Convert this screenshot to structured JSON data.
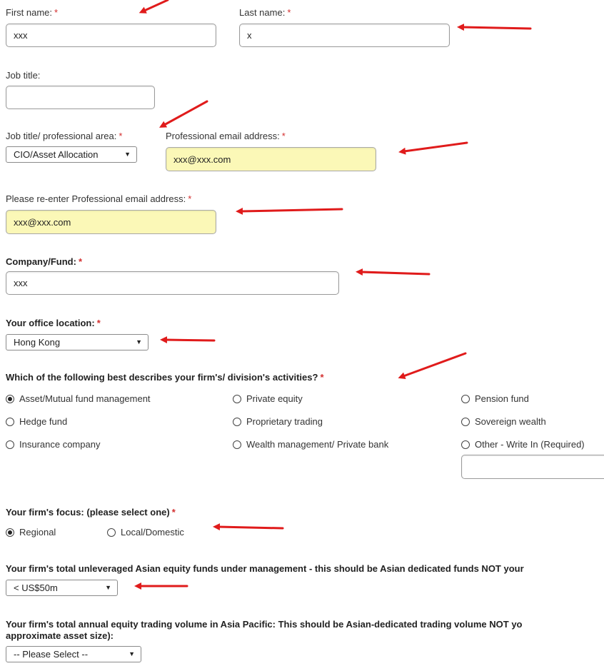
{
  "required_mark": "*",
  "first_name": {
    "label": "First name:",
    "value": "xxx"
  },
  "last_name": {
    "label": "Last name:",
    "value": "x"
  },
  "job_title": {
    "label": "Job title:",
    "value": ""
  },
  "professional_area": {
    "label": "Job title/ professional area:",
    "selected": "CIO/Asset Allocation"
  },
  "email": {
    "label": "Professional email address:",
    "value": "xxx@xxx.com"
  },
  "email_confirm": {
    "label": "Please re-enter Professional email address:",
    "value": "xxx@xxx.com"
  },
  "company": {
    "label": "Company/Fund:",
    "value": "xxx"
  },
  "office_location": {
    "label": "Your office location:",
    "selected": "Hong Kong"
  },
  "activities": {
    "label": "Which of the following best describes your firm's/ division's activities?",
    "options": [
      {
        "label": "Asset/Mutual fund management",
        "checked": true
      },
      {
        "label": "Private equity",
        "checked": false
      },
      {
        "label": "Pension fund",
        "checked": false
      },
      {
        "label": "Hedge fund",
        "checked": false
      },
      {
        "label": "Proprietary trading",
        "checked": false
      },
      {
        "label": "Sovereign wealth",
        "checked": false
      },
      {
        "label": "Insurance company",
        "checked": false
      },
      {
        "label": "Wealth management/ Private bank",
        "checked": false
      },
      {
        "label": "Other - Write In (Required)",
        "checked": false
      }
    ],
    "write_in_value": ""
  },
  "focus": {
    "label": "Your firm's focus: (please select one)",
    "options": [
      {
        "label": "Regional",
        "checked": true
      },
      {
        "label": "Local/Domestic",
        "checked": false
      }
    ]
  },
  "aum": {
    "label": "Your firm's total unleveraged Asian equity funds under management - this should be Asian dedicated funds NOT your",
    "selected": "< US$50m"
  },
  "trading_volume": {
    "label_line1": "Your firm's total annual equity trading volume in Asia Pacific: This should be Asian-dedicated trading volume NOT yo",
    "label_line2": "approximate asset size):",
    "selected": "-- Please Select --"
  },
  "colors": {
    "required": "#d32f2f",
    "highlight": "#fbf8b7",
    "arrow": "#e01b1b"
  },
  "icons": {
    "radio": "radio-icon",
    "dropdown": "chevron-down-icon",
    "annotation": "red-arrow-icon"
  }
}
